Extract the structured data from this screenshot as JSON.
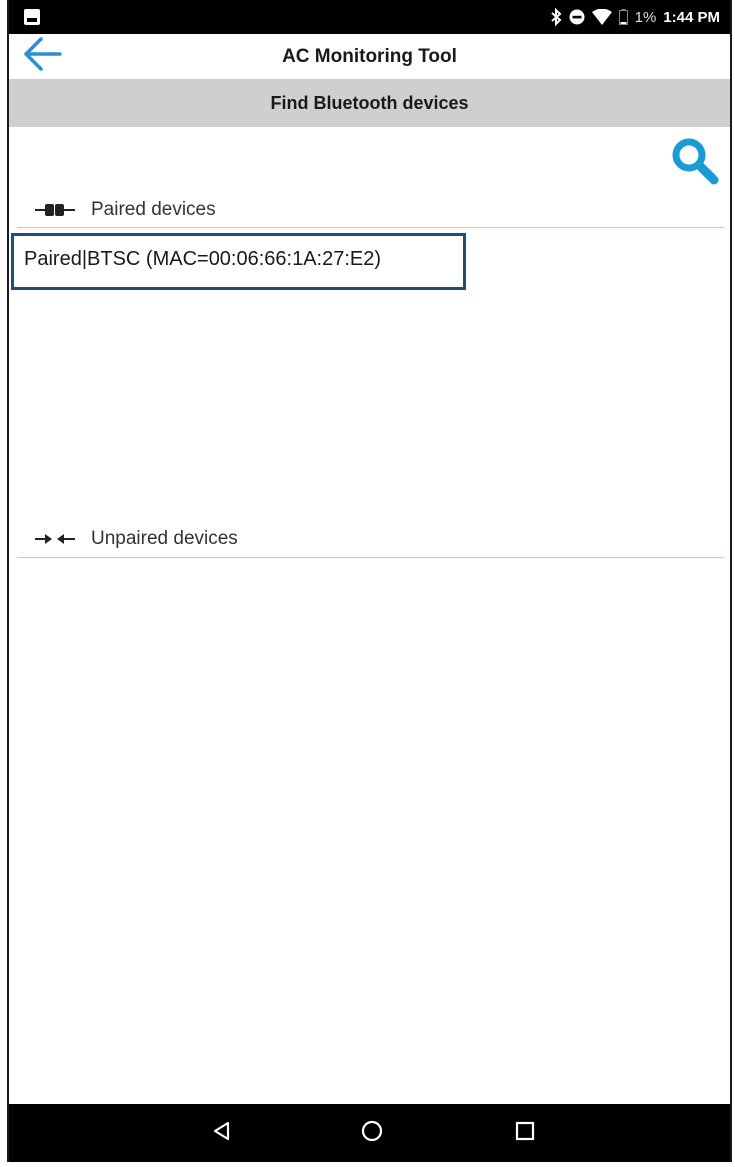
{
  "status_bar": {
    "battery_text": "1%",
    "time": "1:44 PM",
    "icons": [
      "image-notification-icon",
      "bluetooth-icon",
      "do-not-disturb-icon",
      "wifi-icon",
      "battery-icon"
    ]
  },
  "app_bar": {
    "title": "AC Monitoring Tool",
    "back_icon": "arrow-left-icon",
    "accent_color": "#2b8fd1"
  },
  "sub_header": {
    "title": "Find Bluetooth devices",
    "background": "#cfcfcf"
  },
  "search": {
    "icon": "search-icon",
    "color": "#1b9ad6"
  },
  "paired_section": {
    "label": "Paired devices",
    "icon": "plug-connected-icon",
    "devices": [
      {
        "label": "Paired|BTSC (MAC=00:06:66:1A:27:E2)",
        "highlighted": true,
        "highlight_color": "#1f4e79"
      }
    ]
  },
  "unpaired_section": {
    "label": "Unpaired devices",
    "icon": "plug-disconnected-icon",
    "devices": []
  },
  "nav_bar": {
    "buttons": [
      "back-triangle-icon",
      "home-circle-icon",
      "recents-square-icon"
    ]
  }
}
